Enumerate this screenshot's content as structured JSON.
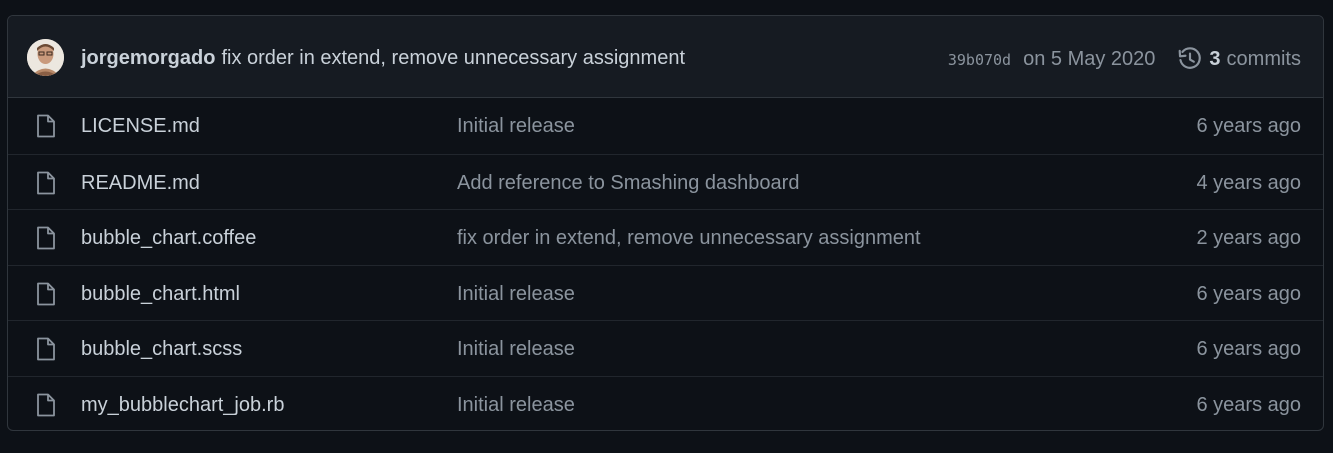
{
  "latest_commit": {
    "author": "jorgemorgado",
    "message": "fix order in extend, remove unnecessary assignment",
    "sha": "39b070d",
    "date": "on 5 May 2020",
    "commits_count": "3",
    "commits_label": "commits",
    "icons": {
      "avatar": "user-avatar",
      "history": "history-icon"
    }
  },
  "files": [
    {
      "name": "LICENSE.md",
      "message": "Initial release",
      "age": "6 years ago",
      "icon": "file-icon"
    },
    {
      "name": "README.md",
      "message": "Add reference to Smashing dashboard",
      "age": "4 years ago",
      "icon": "file-icon"
    },
    {
      "name": "bubble_chart.coffee",
      "message": "fix order in extend, remove unnecessary assignment",
      "age": "2 years ago",
      "icon": "file-icon"
    },
    {
      "name": "bubble_chart.html",
      "message": "Initial release",
      "age": "6 years ago",
      "icon": "file-icon"
    },
    {
      "name": "bubble_chart.scss",
      "message": "Initial release",
      "age": "6 years ago",
      "icon": "file-icon"
    },
    {
      "name": "my_bubblechart_job.rb",
      "message": "Initial release",
      "age": "6 years ago",
      "icon": "file-icon"
    }
  ],
  "colors": {
    "background": "#0d1117",
    "header_bg": "#161b22",
    "border": "#30363d",
    "text": "#c9d1d9",
    "muted": "#8b949e"
  }
}
